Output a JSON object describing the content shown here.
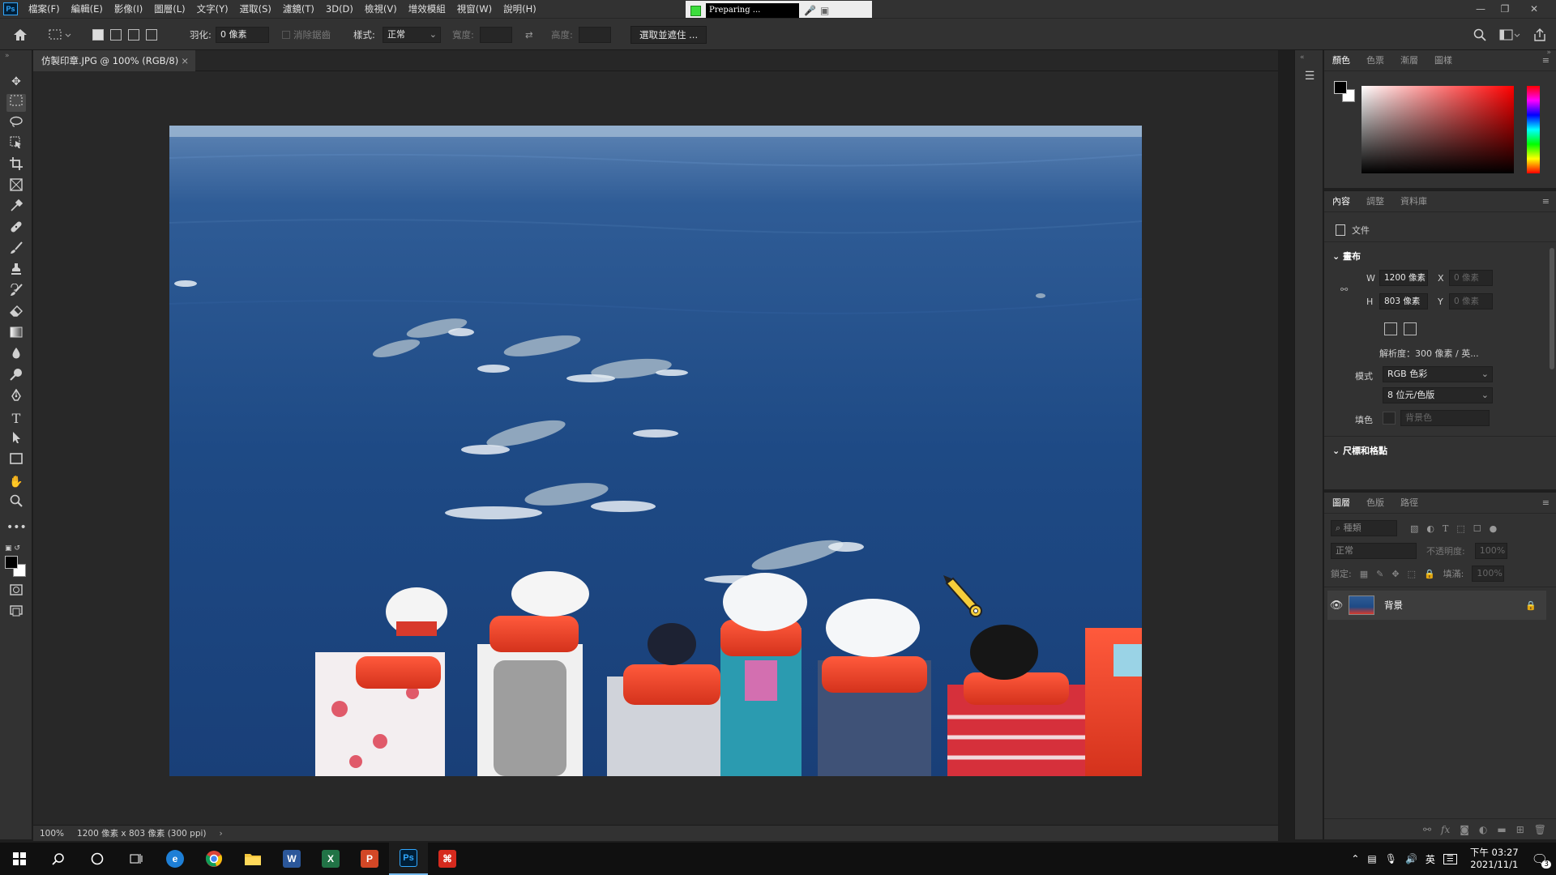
{
  "menubar": {
    "items": [
      "檔案(F)",
      "編輯(E)",
      "影像(I)",
      "圖層(L)",
      "文字(Y)",
      "選取(S)",
      "濾鏡(T)",
      "3D(D)",
      "檢視(V)",
      "增效模組",
      "視窗(W)",
      "說明(H)"
    ],
    "preparing": "Preparing ..."
  },
  "options": {
    "feather_label": "羽化:",
    "feather_value": "0 像素",
    "antialias": "消除鋸齒",
    "style_label": "樣式:",
    "style_value": "正常",
    "width_label": "寬度:",
    "height_label": "高度:",
    "select_mask": "選取並遮住 ..."
  },
  "document": {
    "tab_title": "仿製印章.JPG @ 100% (RGB/8)",
    "zoom": "100%",
    "info": "1200 像素 x 803 像素 (300 ppi)"
  },
  "color_panel": {
    "tabs": [
      "顏色",
      "色票",
      "漸層",
      "圖樣"
    ]
  },
  "properties_panel": {
    "tabs": [
      "內容",
      "調整",
      "資料庫"
    ],
    "doc_label": "文件",
    "canvas_section": "畫布",
    "w_label": "W",
    "w_value": "1200 像素",
    "h_label": "H",
    "h_value": "803 像素",
    "x_label": "X",
    "x_placeholder": "0 像素",
    "y_label": "Y",
    "y_placeholder": "0 像素",
    "resolution": "解析度：300 像素 / 英...",
    "mode_label": "模式",
    "mode_value": "RGB 色彩",
    "depth_value": "8 位元/色版",
    "fill_label": "填色",
    "fill_value": "背景色",
    "rulers_section": "尺標和格點"
  },
  "layers_panel": {
    "tabs": [
      "圖層",
      "色版",
      "路徑"
    ],
    "search_placeholder": "種類",
    "blend_mode": "正常",
    "opacity_label": "不透明度:",
    "opacity_value": "100%",
    "lock_label": "鎖定:",
    "fill_label": "填滿:",
    "fill_value": "100%",
    "layer_name": "背景"
  },
  "taskbar": {
    "time": "下午 03:27",
    "date": "2021/11/1",
    "ime": "英",
    "notif_count": "3"
  },
  "colors": {
    "accent": "#31a8ff",
    "panel_bg": "#323232",
    "canvas_bg": "#282828"
  }
}
